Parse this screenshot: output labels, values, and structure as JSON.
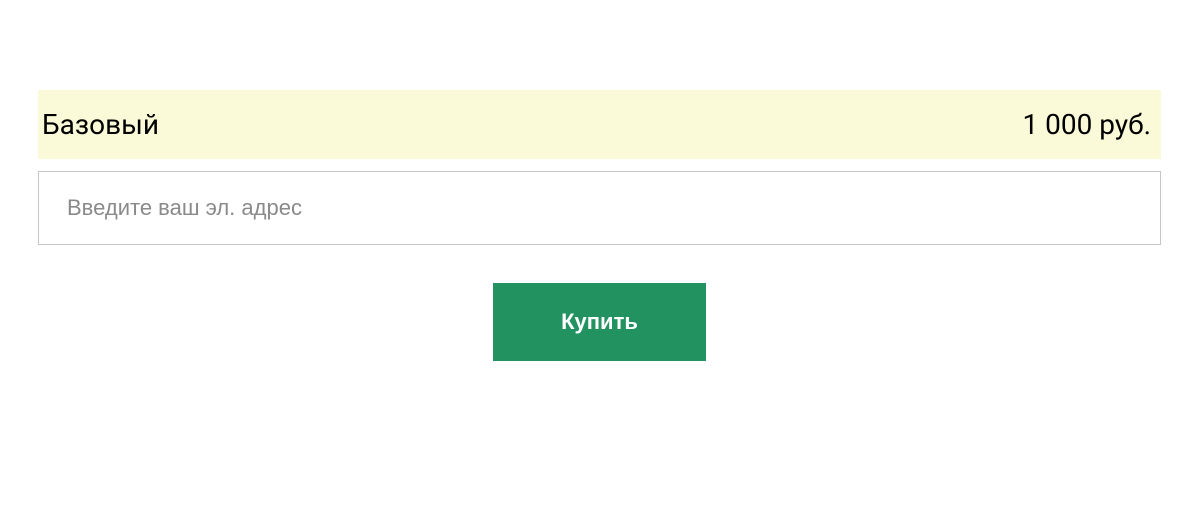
{
  "plan": {
    "name": "Базовый",
    "price": "1 000 руб."
  },
  "form": {
    "email_placeholder": "Введите ваш эл. адрес",
    "buy_label": "Купить"
  }
}
